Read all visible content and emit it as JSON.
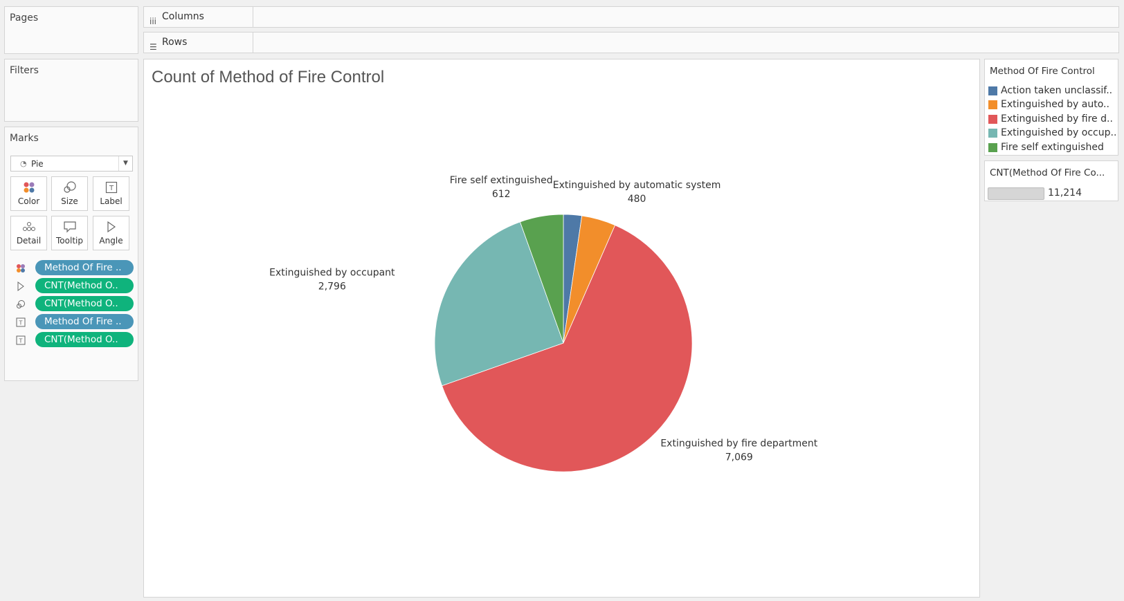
{
  "left": {
    "pages_title": "Pages",
    "filters_title": "Filters",
    "marks_title": "Marks",
    "mark_type": "Pie",
    "mark_buttons": [
      {
        "label": "Color",
        "icon": "color-dots-icon"
      },
      {
        "label": "Size",
        "icon": "size-icon"
      },
      {
        "label": "Label",
        "icon": "label-icon"
      },
      {
        "label": "Detail",
        "icon": "detail-icon"
      },
      {
        "label": "Tooltip",
        "icon": "tooltip-icon"
      },
      {
        "label": "Angle",
        "icon": "angle-icon"
      }
    ],
    "pills": [
      {
        "label": "Method Of Fire ..",
        "kind": "dimension",
        "icon": "color-dots-icon"
      },
      {
        "label": "CNT(Method O..",
        "kind": "measure",
        "icon": "angle-icon"
      },
      {
        "label": "CNT(Method O..",
        "kind": "measure",
        "icon": "size-icon"
      },
      {
        "label": "Method Of Fire ..",
        "kind": "dimension",
        "icon": "label-icon"
      },
      {
        "label": "CNT(Method O..",
        "kind": "measure",
        "icon": "label-icon"
      }
    ]
  },
  "shelves": {
    "columns_label": "Columns",
    "rows_label": "Rows"
  },
  "view": {
    "title": "Count of Method of Fire Control"
  },
  "legend": {
    "title": "Method Of Fire Control",
    "items": [
      {
        "label": "Action taken unclassif..",
        "color": "#4e79a7"
      },
      {
        "label": "Extinguished by auto..",
        "color": "#f28e2b"
      },
      {
        "label": "Extinguished by fire d..",
        "color": "#e15759"
      },
      {
        "label": "Extinguished by occup..",
        "color": "#76b7b2"
      },
      {
        "label": "Fire self extinguished",
        "color": "#59a14f"
      }
    ]
  },
  "size_legend": {
    "title": "CNT(Method Of Fire Co...",
    "value": "11,214"
  },
  "chart_data": {
    "type": "pie",
    "categories": [
      "Action taken unclassified",
      "Extinguished by automatic system",
      "Extinguished by fire department",
      "Extinguished by occupant",
      "Fire self extinguished"
    ],
    "values": [
      257,
      480,
      7069,
      2796,
      612
    ],
    "colors": [
      "#4e79a7",
      "#f28e2b",
      "#e15759",
      "#76b7b2",
      "#59a14f"
    ],
    "labels": [
      {
        "name": "",
        "value": ""
      },
      {
        "name": "Extinguished by automatic system",
        "value": "480"
      },
      {
        "name": "Extinguished by fire department",
        "value": "7,069"
      },
      {
        "name": "Extinguished by occupant",
        "value": "2,796"
      },
      {
        "name": "Fire self extinguished",
        "value": "612"
      }
    ],
    "title": "Count of Method of Fire Control",
    "legend": "right"
  }
}
